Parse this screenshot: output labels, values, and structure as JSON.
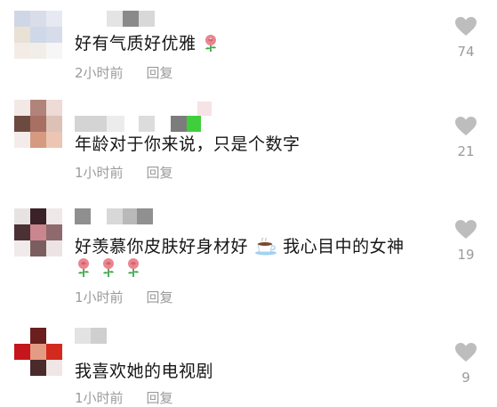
{
  "comments": [
    {
      "text": "好有气质好优雅",
      "time": "2小时前",
      "reply": "回复",
      "likes": "74"
    },
    {
      "text": "年龄对于你来说，只是个数字",
      "time": "1小时前",
      "reply": "回复",
      "likes": "21"
    },
    {
      "text_before": "好羡慕你皮肤好身材好",
      "text_after": "我心目中的女神",
      "time": "1小时前",
      "reply": "回复",
      "likes": "19"
    },
    {
      "text": "我喜欢她的电视剧",
      "time": "1小时前",
      "reply": "回复",
      "likes": "9"
    }
  ],
  "icons": {
    "like": "heart-icon",
    "rose": "rose-emoji",
    "coffee": "coffee-emoji"
  },
  "colors": {
    "heart": "#bdbdbd",
    "meta_text": "#9b9b9b",
    "comment_text": "#161616",
    "rose": "#e9868f",
    "leaf": "#3aa745"
  }
}
